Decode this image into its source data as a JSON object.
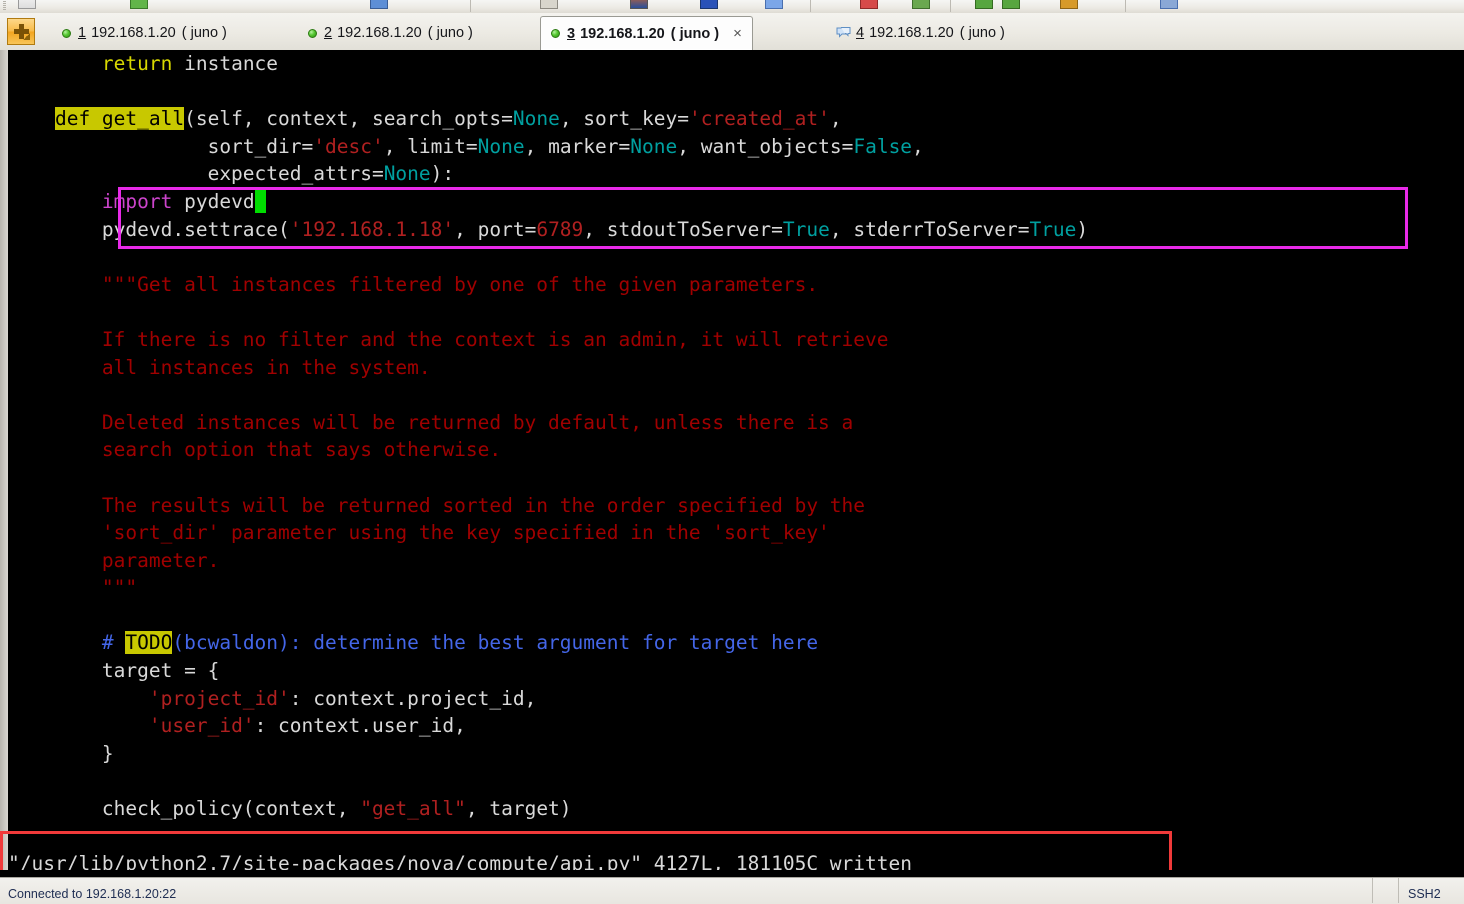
{
  "window": {
    "app": "SecureCRT",
    "toolbar_icons": [
      "new-session-icon",
      "connect-icon",
      "quick-connect-icon",
      "print-icon",
      "copy-icon",
      "paste-icon",
      "find-icon",
      "log-icon",
      "transfer-icon",
      "properties-icon",
      "help-icon"
    ]
  },
  "tabbar": {
    "new_tab_label": "+",
    "tabs": [
      {
        "num": "1",
        "host": "192.168.1.20",
        "session": "( juno )",
        "active": false,
        "icon": "green-dot-icon"
      },
      {
        "num": "2",
        "host": "192.168.1.20",
        "session": "( juno )",
        "active": false,
        "icon": "green-dot-icon"
      },
      {
        "num": "3",
        "host": "192.168.1.20",
        "session": "( juno )",
        "active": true,
        "icon": "green-dot-icon",
        "close_label": "×"
      },
      {
        "num": "4",
        "host": "192.168.1.20",
        "session": "( juno )",
        "active": false,
        "icon": "chat-bubble-icon"
      }
    ]
  },
  "terminal": {
    "background": "#000000",
    "foreground": "#d9d9d9",
    "cursor_color": "#00dd00",
    "cursor_after_text": "import pydevd",
    "lines": [
      {
        "id": "l01",
        "segments": [
          {
            "t": "        ",
            "c": "fg"
          },
          {
            "t": "return",
            "c": "kw"
          },
          {
            "t": " instance",
            "c": "fg"
          }
        ]
      },
      {
        "id": "l02",
        "segments": [
          {
            "t": "",
            "c": "fg"
          }
        ]
      },
      {
        "id": "l03",
        "segments": [
          {
            "t": "    ",
            "c": "fg"
          },
          {
            "t": "def get_all",
            "c": "hl"
          },
          {
            "t": "(self, context, search_opts=",
            "c": "fg"
          },
          {
            "t": "None",
            "c": "cst"
          },
          {
            "t": ", sort_key=",
            "c": "fg"
          },
          {
            "t": "'created_at'",
            "c": "str"
          },
          {
            "t": ",",
            "c": "fg"
          }
        ]
      },
      {
        "id": "l04",
        "segments": [
          {
            "t": "                 sort_dir=",
            "c": "fg"
          },
          {
            "t": "'desc'",
            "c": "str"
          },
          {
            "t": ", limit=",
            "c": "fg"
          },
          {
            "t": "None",
            "c": "cst"
          },
          {
            "t": ", marker=",
            "c": "fg"
          },
          {
            "t": "None",
            "c": "cst"
          },
          {
            "t": ", want_objects=",
            "c": "fg"
          },
          {
            "t": "False",
            "c": "cst"
          },
          {
            "t": ",",
            "c": "fg"
          }
        ]
      },
      {
        "id": "l05",
        "segments": [
          {
            "t": "                 expected_attrs=",
            "c": "fg"
          },
          {
            "t": "None",
            "c": "cst"
          },
          {
            "t": "):",
            "c": "fg"
          }
        ]
      },
      {
        "id": "l06",
        "segments": [
          {
            "t": "        ",
            "c": "fg"
          },
          {
            "t": "import",
            "c": "imp"
          },
          {
            "t": " pydevd",
            "c": "fg"
          },
          {
            "t": " ",
            "c": "cursor"
          }
        ]
      },
      {
        "id": "l07",
        "segments": [
          {
            "t": "        pydevd.settrace(",
            "c": "fg"
          },
          {
            "t": "'192.168.1.18'",
            "c": "str"
          },
          {
            "t": ", port=",
            "c": "fg"
          },
          {
            "t": "6789",
            "c": "num"
          },
          {
            "t": ", stdoutToServer=",
            "c": "fg"
          },
          {
            "t": "True",
            "c": "cst"
          },
          {
            "t": ", stderrToServer=",
            "c": "fg"
          },
          {
            "t": "True",
            "c": "cst"
          },
          {
            "t": ")",
            "c": "fg"
          }
        ]
      },
      {
        "id": "l08",
        "segments": [
          {
            "t": "",
            "c": "fg"
          }
        ]
      },
      {
        "id": "l09",
        "segments": [
          {
            "t": "        \"\"\"Get all instances filtered by one of the given parameters.",
            "c": "doc"
          }
        ]
      },
      {
        "id": "l10",
        "segments": [
          {
            "t": "",
            "c": "fg"
          }
        ]
      },
      {
        "id": "l11",
        "segments": [
          {
            "t": "        If there is no filter and the context is an admin, it will retrieve",
            "c": "doc"
          }
        ]
      },
      {
        "id": "l12",
        "segments": [
          {
            "t": "        all instances in the system.",
            "c": "doc"
          }
        ]
      },
      {
        "id": "l13",
        "segments": [
          {
            "t": "",
            "c": "fg"
          }
        ]
      },
      {
        "id": "l14",
        "segments": [
          {
            "t": "        Deleted instances will be returned by default, unless there is a",
            "c": "doc"
          }
        ]
      },
      {
        "id": "l15",
        "segments": [
          {
            "t": "        search option that says otherwise.",
            "c": "doc"
          }
        ]
      },
      {
        "id": "l16",
        "segments": [
          {
            "t": "",
            "c": "fg"
          }
        ]
      },
      {
        "id": "l17",
        "segments": [
          {
            "t": "        The results will be returned sorted in the order specified by the",
            "c": "doc"
          }
        ]
      },
      {
        "id": "l18",
        "segments": [
          {
            "t": "        'sort_dir' parameter using the key specified in the 'sort_key'",
            "c": "doc"
          }
        ]
      },
      {
        "id": "l19",
        "segments": [
          {
            "t": "        parameter.",
            "c": "doc"
          }
        ]
      },
      {
        "id": "l20",
        "segments": [
          {
            "t": "        \"\"\"",
            "c": "doc"
          }
        ]
      },
      {
        "id": "l21",
        "segments": [
          {
            "t": "",
            "c": "fg"
          }
        ]
      },
      {
        "id": "l22",
        "segments": [
          {
            "t": "        # ",
            "c": "cmt"
          },
          {
            "t": "TODO",
            "c": "hl"
          },
          {
            "t": "(bcwaldon): determine the best argument for target here",
            "c": "cmt"
          }
        ]
      },
      {
        "id": "l23",
        "segments": [
          {
            "t": "        target = {",
            "c": "fg"
          }
        ]
      },
      {
        "id": "l24",
        "segments": [
          {
            "t": "            ",
            "c": "fg"
          },
          {
            "t": "'project_id'",
            "c": "str"
          },
          {
            "t": ": context.project_id,",
            "c": "fg"
          }
        ]
      },
      {
        "id": "l25",
        "segments": [
          {
            "t": "            ",
            "c": "fg"
          },
          {
            "t": "'user_id'",
            "c": "str"
          },
          {
            "t": ": context.user_id,",
            "c": "fg"
          }
        ]
      },
      {
        "id": "l26",
        "segments": [
          {
            "t": "        }",
            "c": "fg"
          }
        ]
      },
      {
        "id": "l27",
        "segments": [
          {
            "t": "",
            "c": "fg"
          }
        ]
      },
      {
        "id": "l28",
        "segments": [
          {
            "t": "        check_policy(context, ",
            "c": "fg"
          },
          {
            "t": "\"get_all\"",
            "c": "str"
          },
          {
            "t": ", target)",
            "c": "fg"
          }
        ]
      },
      {
        "id": "l29",
        "segments": [
          {
            "t": "",
            "c": "fg"
          }
        ]
      },
      {
        "id": "l30",
        "segments": [
          {
            "t": "\"/usr/lib/python2.7/site-packages/nova/compute/api.py\" 4127L, 181105C written",
            "c": "fg"
          }
        ]
      }
    ],
    "status_message": "\"/usr/lib/python2.7/site-packages/nova/compute/api.py\" 4127L, 181105C written"
  },
  "annotations": [
    {
      "name": "pydevd-highlight-box",
      "color": "#e82ae8"
    },
    {
      "name": "written-status-box",
      "color": "#f03a3a"
    }
  ],
  "statusbar": {
    "connection": "Connected to 192.168.1.20:22",
    "protocol": "SSH2"
  }
}
